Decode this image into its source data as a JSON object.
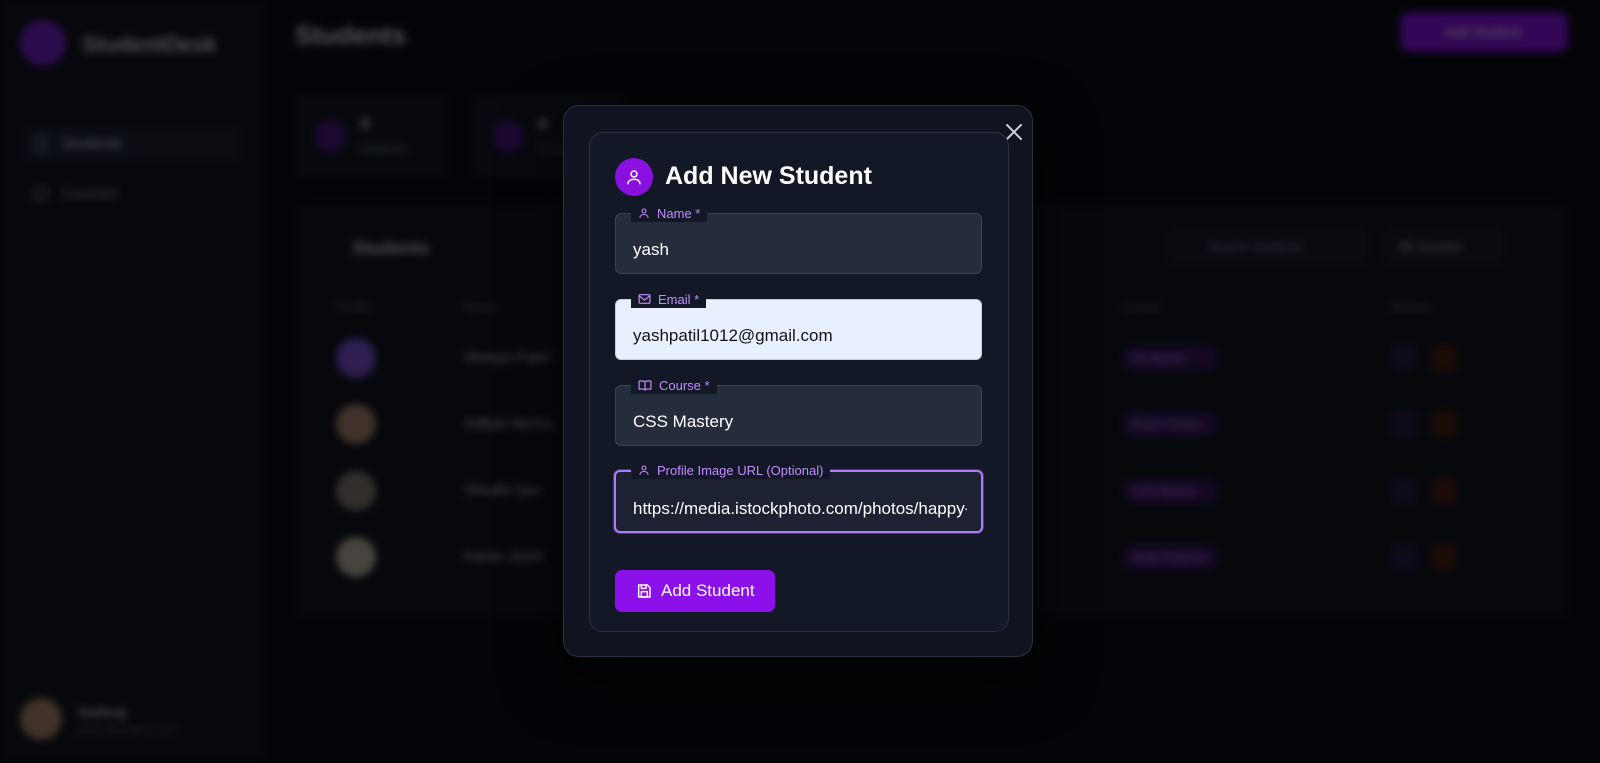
{
  "app": {
    "brand": "StudentDesk",
    "page_title": "Students",
    "top_action_label": "Add Student",
    "nav": [
      {
        "label": "Students"
      },
      {
        "label": "Courses"
      }
    ],
    "user": {
      "name": "Yashraj",
      "sub": "admin@student.com"
    },
    "stats": [
      {
        "value": "4",
        "label": "Students"
      },
      {
        "value": "4",
        "label": "Courses"
      }
    ],
    "table": {
      "title": "Students",
      "search_placeholder": "Search students",
      "filter_label": "All courses",
      "headers": [
        "Profile",
        "Name",
        "Course",
        "Actions"
      ],
      "rows": [
        {
          "name": "Shreya Patel",
          "course": "JS Master",
          "avatar_color": "#7b4fd6"
        },
        {
          "name": "Aditya Verma",
          "course": "React Hooks",
          "avatar_color": "#b08a6a"
        },
        {
          "name": "Shruthi Iyer",
          "course": "CSS Basics",
          "avatar_color": "#8a7d74"
        },
        {
          "name": "Karan Joshi",
          "course": "Node Express",
          "avatar_color": "#c7b9a4"
        }
      ]
    }
  },
  "modal": {
    "title": "Add New Student",
    "close_icon": "close-icon",
    "fields": {
      "name": {
        "label": "Name *",
        "value": "yash",
        "icon": "user-icon"
      },
      "email": {
        "label": "Email *",
        "value": "yashpatil1012@gmail.com",
        "icon": "mail-icon"
      },
      "course": {
        "label": "Course *",
        "value": "CSS Mastery",
        "icon": "book-icon"
      },
      "image": {
        "label": "Profile Image URL (Optional)",
        "value": "https://media.istockphoto.com/photos/happy-",
        "icon": "user-icon"
      }
    },
    "submit_label": "Add Student",
    "submit_icon": "save-icon"
  },
  "colors": {
    "accent": "#8c10ea",
    "label": "#c58cff",
    "modal_bg": "#0f141e",
    "field_bg": "#252d3d",
    "autofill_bg": "#e8f0fe"
  }
}
